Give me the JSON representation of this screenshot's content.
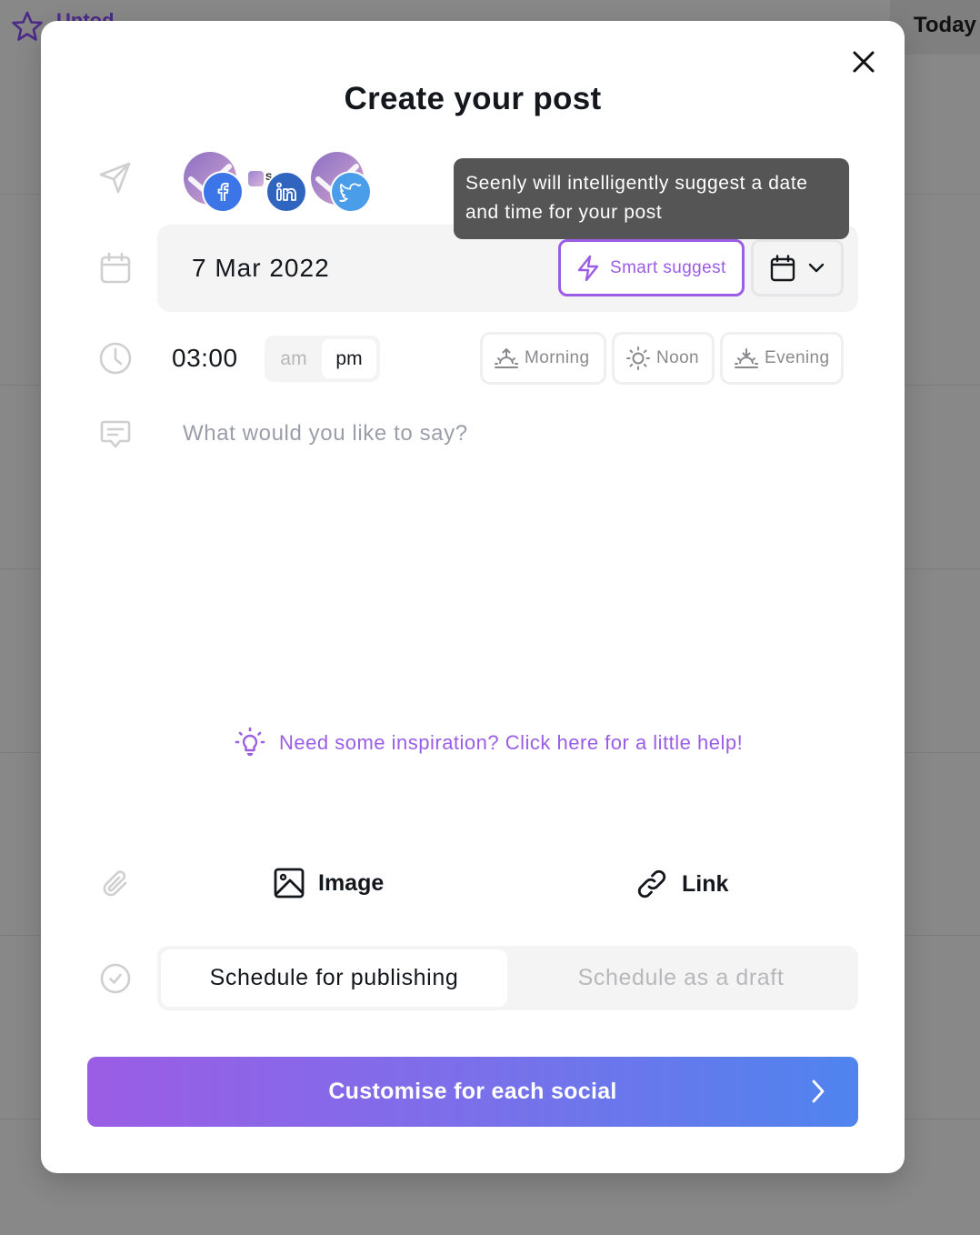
{
  "background": {
    "app_title": "Untod",
    "today_button": "Today"
  },
  "modal": {
    "title": "Create your post",
    "close_label": "close",
    "accounts": [
      {
        "platform": "facebook",
        "badge_color": "#3b75e8"
      },
      {
        "platform": "seenly-small",
        "label": "S"
      },
      {
        "platform": "linkedin",
        "badge_color": "#2f64bf"
      },
      {
        "platform": "twitter",
        "badge_color": "#4a9de8"
      }
    ],
    "date": {
      "value": "7 Mar 2022",
      "smart_suggest_label": "Smart suggest",
      "tooltip": "Seenly will intelligently suggest a date and time for your post"
    },
    "time": {
      "value": "03:00",
      "am_label": "am",
      "pm_label": "pm",
      "selected_period": "pm",
      "presets": [
        {
          "label": "Morning",
          "icon": "sunrise-icon"
        },
        {
          "label": "Noon",
          "icon": "sun-icon"
        },
        {
          "label": "Evening",
          "icon": "sunset-icon"
        }
      ]
    },
    "message": {
      "value": "",
      "placeholder": "What would you like to say?"
    },
    "inspiration_link": "Need some inspiration? Click here for a little help!",
    "attachments": {
      "image_label": "Image",
      "link_label": "Link"
    },
    "schedule": {
      "publish_label": "Schedule for publishing",
      "draft_label": "Schedule as a draft",
      "selected": "publish"
    },
    "cta_label": "Customise for each social"
  },
  "colors": {
    "accent_purple": "#9b5de5",
    "accent_blue": "#4f84ee",
    "tooltip_bg": "#555555"
  }
}
